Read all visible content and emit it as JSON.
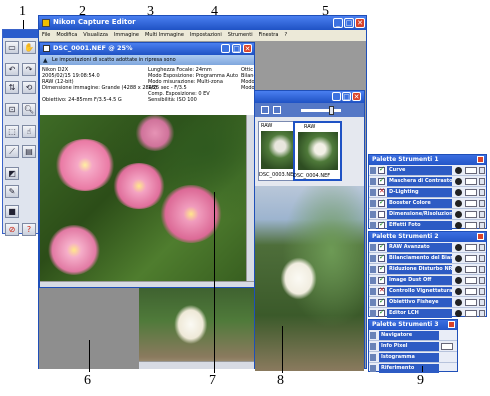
{
  "callouts": [
    "1",
    "2",
    "3",
    "4",
    "5",
    "6",
    "7",
    "8",
    "9"
  ],
  "app": {
    "title": "Nikon Capture Editor",
    "menu": [
      "File",
      "Modifica",
      "Visualizza",
      "Immagine",
      "Multi Immagine",
      "Impostazioni",
      "Strumenti",
      "Finestra",
      "?"
    ]
  },
  "doc": {
    "title": "DSC_0001.NEF @ 25%",
    "banner": "Le impostazioni di scatto adottate in ripresa sono",
    "info_col1": [
      "Nikon D2X",
      "2005/02/15 19:08:54.0",
      "RAW (12-bit)",
      "Dimensione immagine: Grande (4288 x 2848)",
      "",
      "Obiettivo: 24-85mm F/3.5-4.5 G"
    ],
    "info_col2": [
      "Lunghezza Focale: 24mm",
      "Modo Esposizione: Programma Auto",
      "Modo misurazione: Multi-zona",
      "1/25 sec - F/3.5",
      "Comp. Esposizione: 0 EV",
      "Sensibilità: ISO 100"
    ],
    "info_col3": [
      "Ottic",
      "Bilanc",
      "Modo",
      "Modo"
    ]
  },
  "browser": {
    "thumbs": [
      {
        "label": "DSC_0003.NEF",
        "tag": "RAW"
      },
      {
        "label": "DSC_0004.NEF",
        "tag": "RAW"
      }
    ]
  },
  "palettes": [
    {
      "title": "Palette Strumenti 1",
      "items": [
        {
          "label": "Curve",
          "state": "on"
        },
        {
          "label": "Maschera di Contrasto",
          "state": "on"
        },
        {
          "label": "D-Lighting",
          "state": "no"
        },
        {
          "label": "Booster Colore",
          "state": "on"
        },
        {
          "label": "Dimensione/Risoluzione",
          "state": "off"
        },
        {
          "label": "Effetti Foto",
          "state": "on"
        }
      ]
    },
    {
      "title": "Palette Strumenti 2",
      "items": [
        {
          "label": "RAW Avanzato",
          "state": "on"
        },
        {
          "label": "Bilanciamento del Bianco",
          "state": "on"
        },
        {
          "label": "Riduzione Disturbo NR",
          "state": "on"
        },
        {
          "label": "Image Dust Off",
          "state": "on"
        },
        {
          "label": "Controllo Vignettatura",
          "state": "no"
        },
        {
          "label": "Obiettivo Fisheye",
          "state": "on"
        },
        {
          "label": "Editor LCH",
          "state": "on"
        }
      ]
    },
    {
      "title": "Palette Strumenti 3",
      "items": [
        {
          "label": "Navigatore"
        },
        {
          "label": "Info Pixel"
        },
        {
          "label": "Istogramma"
        },
        {
          "label": "Riferimento"
        }
      ]
    }
  ],
  "colors": {
    "titlebar": "#2456c8",
    "close": "#d9432a",
    "canvas_gray": "#8e8e8e",
    "palette_item": "#2d5bc4"
  },
  "icons": {
    "app": "nikon-capture-icon",
    "thumb_view": "thumbnail-view-icon"
  }
}
